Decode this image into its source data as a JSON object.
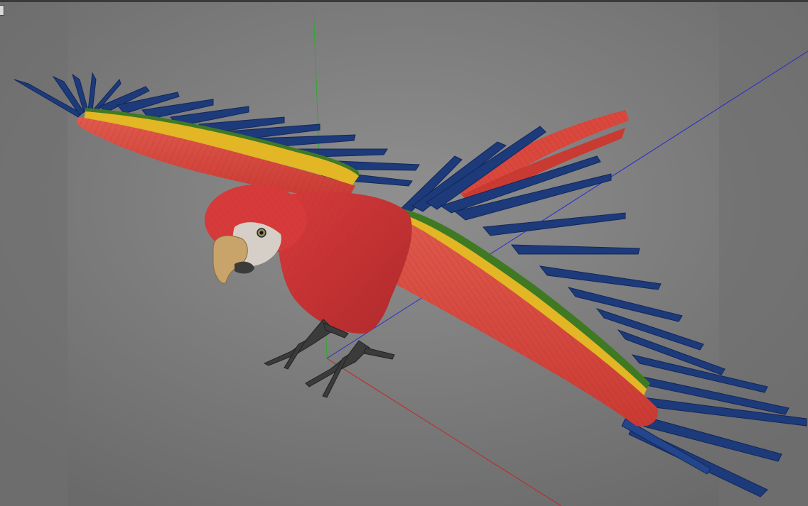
{
  "viewport": {
    "label": "3D viewport",
    "background_center": "#8e8e8e",
    "background_edge": "#6a6a6a",
    "side_band": "#747474"
  },
  "axes": {
    "x_color": "#c0282a",
    "y_color": "#2fa82f",
    "z_color": "#2b2bcf"
  },
  "model": {
    "name": "scarlet-macaw",
    "colors": {
      "red": "#d9473d",
      "red_dark": "#b8302b",
      "yellow": "#e2b624",
      "green": "#3f7a22",
      "blue": "#1d3a7a",
      "blue_dark": "#13275a",
      "beak": "#c8a46a",
      "face": "#d6cfc8",
      "talon": "#3b3b3b"
    }
  },
  "icons": {
    "corner": "viewport-corner-icon"
  }
}
